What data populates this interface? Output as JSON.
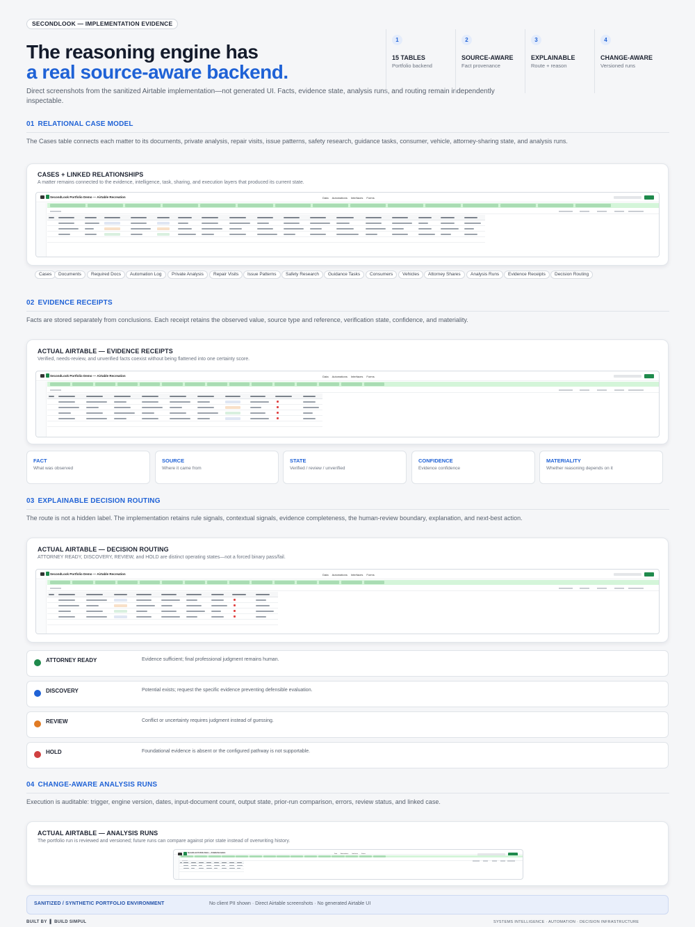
{
  "header": {
    "eyebrow": "SECONDLOOK — IMPLEMENTATION EVIDENCE",
    "title_line1": "The reasoning engine has",
    "title_line2": "a real source-aware backend.",
    "lead": "Direct screenshots from the sanitized Airtable implementation—not generated UI. Facts, evidence state, analysis runs, and routing remain independently inspectable."
  },
  "stats": [
    {
      "num": "1",
      "title": "15 TABLES",
      "sub": "Portfolio backend"
    },
    {
      "num": "2",
      "title": "SOURCE-AWARE",
      "sub": "Fact provenance"
    },
    {
      "num": "3",
      "title": "EXPLAINABLE",
      "sub": "Route + reason"
    },
    {
      "num": "4",
      "title": "CHANGE-AWARE",
      "sub": "Versioned runs"
    }
  ],
  "sections": {
    "s1": {
      "num": "01",
      "title": "RELATIONAL CASE MODEL",
      "desc": "The Cases table connects each matter to its documents, private analysis, repair visits, issue patterns, safety research, guidance tasks, consumer, vehicle, attorney-sharing state, and analysis runs.",
      "card_title": "CASES + LINKED RELATIONSHIPS",
      "card_sub": "A matter remains connected to the evidence, intelligence, task, sharing, and execution layers that produced its current state."
    },
    "s2": {
      "num": "02",
      "title": "EVIDENCE RECEIPTS",
      "desc": "Facts are stored separately from conclusions. Each receipt retains the observed value, source type and reference, verification state, confidence, and materiality.",
      "card_title": "ACTUAL AIRTABLE — EVIDENCE RECEIPTS",
      "card_sub": "Verified, needs-review, and unverified facts coexist without being flattened into one certainty score."
    },
    "s3": {
      "num": "03",
      "title": "EXPLAINABLE DECISION ROUTING",
      "desc": "The route is not a hidden label. The implementation retains rule signals, contextual signals, evidence completeness, the human-review boundary, explanation, and next-best action.",
      "card_title": "ACTUAL AIRTABLE — DECISION ROUTING",
      "card_sub": "ATTORNEY READY, DISCOVERY, REVIEW, and HOLD are distinct operating states—not a forced binary pass/fail."
    },
    "s4": {
      "num": "04",
      "title": "CHANGE-AWARE ANALYSIS RUNS",
      "desc": "Execution is auditable: trigger, engine version, dates, input-document count, output state, prior-run comparison, errors, review status, and linked case.",
      "card_title": "ACTUAL AIRTABLE — ANALYSIS RUNS",
      "card_sub": "The portfolio run is reviewed and versioned; future runs can compare against prior state instead of overwriting history."
    }
  },
  "screenshot": {
    "base_name": "SecondLook Portfolio Demo — Airtable Recreation",
    "navs": [
      "Data",
      "Automations",
      "Interfaces",
      "Forms"
    ]
  },
  "tables": [
    "Cases",
    "Documents",
    "Required Docs",
    "Automation Log",
    "Private Analysis",
    "Repair Visits",
    "Issue Patterns",
    "Safety Research",
    "Guidance Tasks",
    "Consumers",
    "Vehicles",
    "Attorney Shares",
    "Analysis Runs",
    "Evidence Receipts",
    "Decision Routing"
  ],
  "facets": [
    {
      "title": "FACT",
      "sub": "What was observed"
    },
    {
      "title": "SOURCE",
      "sub": "Where it came from"
    },
    {
      "title": "STATE",
      "sub": "Verified / review / unverified"
    },
    {
      "title": "CONFIDENCE",
      "sub": "Evidence confidence"
    },
    {
      "title": "MATERIALITY",
      "sub": "Whether reasoning depends on it"
    }
  ],
  "routes": [
    {
      "name": "ATTORNEY READY",
      "desc": "Evidence sufficient; final professional judgment remains human.",
      "color": "#1f8a4c"
    },
    {
      "name": "DISCOVERY",
      "desc": "Potential exists; request the specific evidence preventing defensible evaluation.",
      "color": "#1f62d6"
    },
    {
      "name": "REVIEW",
      "desc": "Conflict or uncertainty requires judgment instead of guessing.",
      "color": "#e07b24"
    },
    {
      "name": "HOLD",
      "desc": "Foundational evidence is absent or the configured pathway is not supportable.",
      "color": "#d04040"
    }
  ],
  "banner": {
    "label": "SANITIZED / SYNTHETIC PORTFOLIO ENVIRONMENT",
    "text": "No client PII shown · Direct Airtable screenshots · No generated Airtable UI"
  },
  "footer": {
    "left_prefix": "BUILT BY",
    "left_brand": "BUILD SIMPUL",
    "right": "SYSTEMS INTELLIGENCE  ·  AUTOMATION  ·  DECISION INFRASTRUCTURE"
  },
  "colors": {
    "accent": "#1f62d6",
    "airtable_green": "#1f8a4c",
    "tab_bar": "#d4f5d9"
  }
}
